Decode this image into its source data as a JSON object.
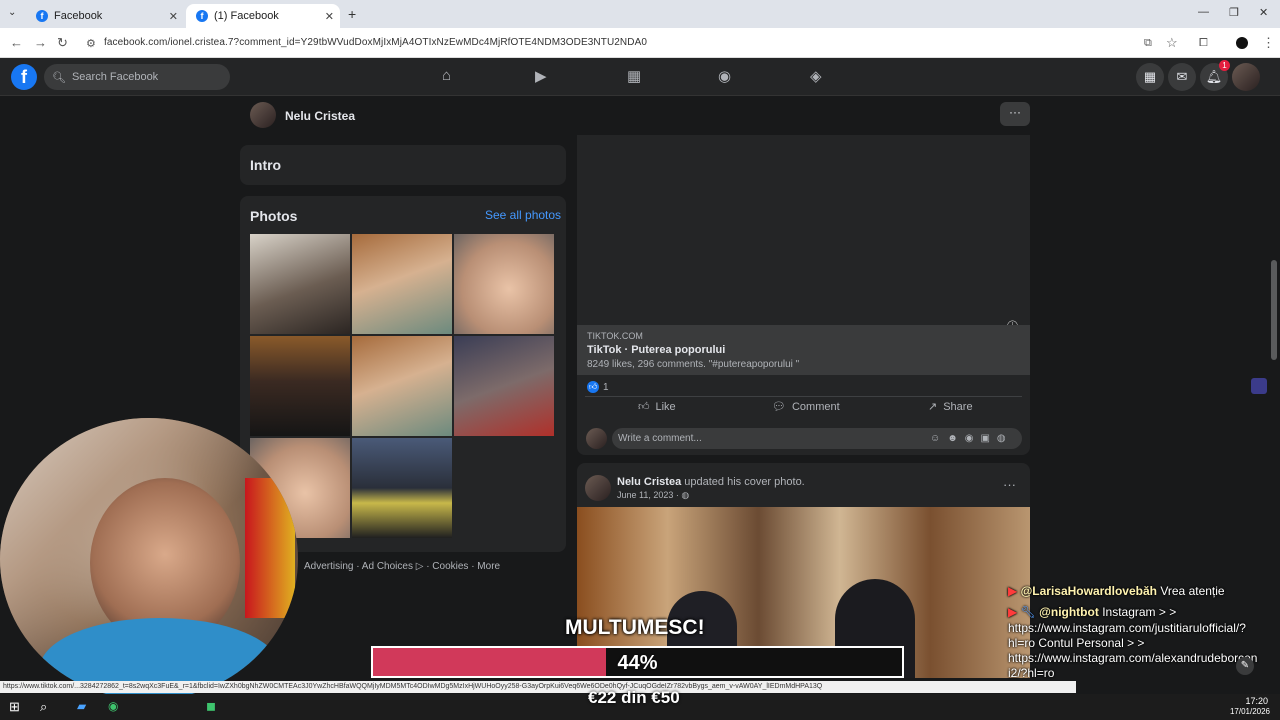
{
  "browser": {
    "tabs": [
      {
        "title": "Facebook"
      },
      {
        "title": "(1) Facebook"
      }
    ],
    "url": "facebook.com/ionel.cristea.7?comment_id=Y29tbWVudDoxMjIxMjA4OTIxNzEwMDc4MjRfOTE4NDM3ODE3NTU2NDA0",
    "status_url": "https://www.tiktok.com/...3284272862_t=8s2wqXc3FuE&_r=1&fbclid=IwZXh0bgNhZW0CMTEAc3J0YwZhcHBfaWQQMjIyMDM5MTc4ODIwMDg5MzIxHjWUHoOyy258-G3ayOrpKui6Veq6We6ODe0hQyf-JCuqOGdeIZr782vbBygs_aem_v-vAW0AY_lIEDmMdHPA13Q"
  },
  "fb": {
    "search_placeholder": "Search Facebook",
    "notifications": "1"
  },
  "profile": {
    "name": "Nelu Cristea"
  },
  "left": {
    "intro_title": "Intro",
    "photos_title": "Photos",
    "see_all": "See all photos",
    "footer": "Advertising · Ad Choices ▷ · Cookies · More"
  },
  "post1": {
    "source": "TIKTOK.COM",
    "title": "TikTok · Puterea poporului",
    "desc": "8249 likes, 296 comments. \"#putereapoporului \"",
    "reactions": "1",
    "like": "Like",
    "comment": "Comment",
    "share": "Share",
    "comment_placeholder": "Write a comment..."
  },
  "post2": {
    "author": "Nelu Cristea",
    "action": "updated his cover photo.",
    "date": "June 11, 2023 · "
  },
  "overlay": {
    "chat": [
      {
        "user": "@LarisaHowardlovebăh",
        "text": "Vrea atenție"
      },
      {
        "user": "@nightbot",
        "text": "Instagram > >"
      },
      {
        "user": "",
        "text": "https://www.instagram.com/justitiarulofficial/?"
      },
      {
        "user": "",
        "text": "hl=ro Contul Personal > >"
      },
      {
        "user": "",
        "text": "https://www.instagram.com/alexandrudeborcen"
      },
      {
        "user": "",
        "text": "i2/?hl=ro"
      }
    ],
    "thanks": "MULTUMESC!",
    "progress_pct": 44,
    "progress_label": "44%",
    "goal": "€22 din €50"
  },
  "taskbar": {
    "time": "17:20",
    "date": "17/01/2026"
  }
}
